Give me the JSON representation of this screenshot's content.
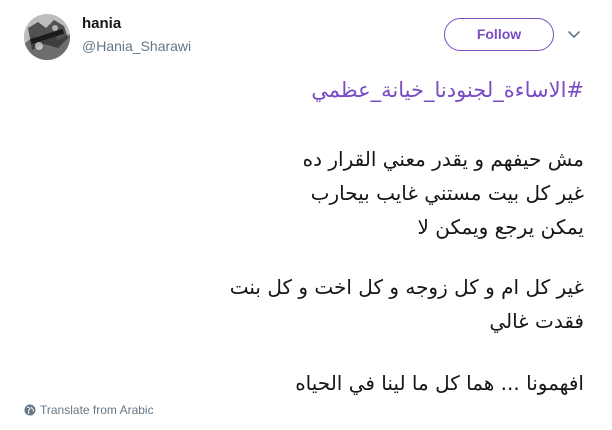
{
  "author": {
    "name": "hania",
    "handle": "@Hania_Sharawi"
  },
  "follow_button": {
    "label": "Follow"
  },
  "tweet": {
    "hashtag": "#الاساءة_لجنودنا_خيانة_عظمي",
    "paragraph1": [
      "مش حيفهم و يقدر معني القرار ده",
      "غير كل بيت مستني غايب بيحارب",
      "يمكن يرجع ويمكن لا"
    ],
    "paragraph2": [
      "غير كل ام و كل زوجه و كل اخت و كل بنت",
      "فقدت غالي"
    ],
    "paragraph3": [
      "افهمونا ... هما كل ما لينا في الحياه"
    ]
  },
  "translate": {
    "label": "Translate from Arabic"
  },
  "colors": {
    "accent": "#794bc4",
    "text": "#14171a",
    "muted": "#657786"
  },
  "icons": {
    "menu": "chevron-down-icon",
    "translate": "globe-icon"
  }
}
